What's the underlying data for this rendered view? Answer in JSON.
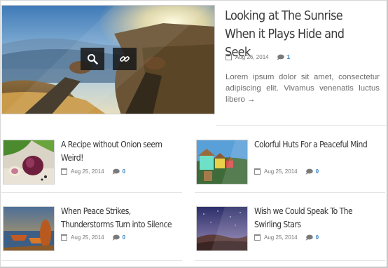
{
  "featured": {
    "title": "Looking at The Sunrise When it Plays Hide and Seek",
    "date": "Aug 26, 2014",
    "comments": "1",
    "excerpt": "Lorem ipsum dolor sit amet, consectetur adipiscing elit. Vivamus venenatis luctus libero",
    "more_arrow": "→",
    "image": "hiker-feet-sunrise-photo",
    "overlay_icons": [
      "search-icon",
      "link-icon"
    ]
  },
  "posts": [
    {
      "title": "A Recipe without Onion seem Weird!",
      "date": "Aug 25, 2014",
      "comments": "0",
      "image": "red-onion-photo"
    },
    {
      "title": "Colorful Huts For a Peaceful Mind",
      "date": "Aug 25, 2014",
      "comments": "0",
      "image": "colorful-huts-photo"
    },
    {
      "title": "When Peace Strikes, Thunderstorms Turn into Silence",
      "date": "Aug 25, 2014",
      "comments": "0",
      "image": "boats-lake-photo"
    },
    {
      "title": "Wish we Could Speak To The Swirling Stars",
      "date": "Aug 25, 2014",
      "comments": "0",
      "image": "starry-sky-photo"
    }
  ],
  "colors": {
    "title": "#333333",
    "accent": "#2f7fc2",
    "meta": "#777777",
    "excerpt": "#6b6b6b"
  }
}
